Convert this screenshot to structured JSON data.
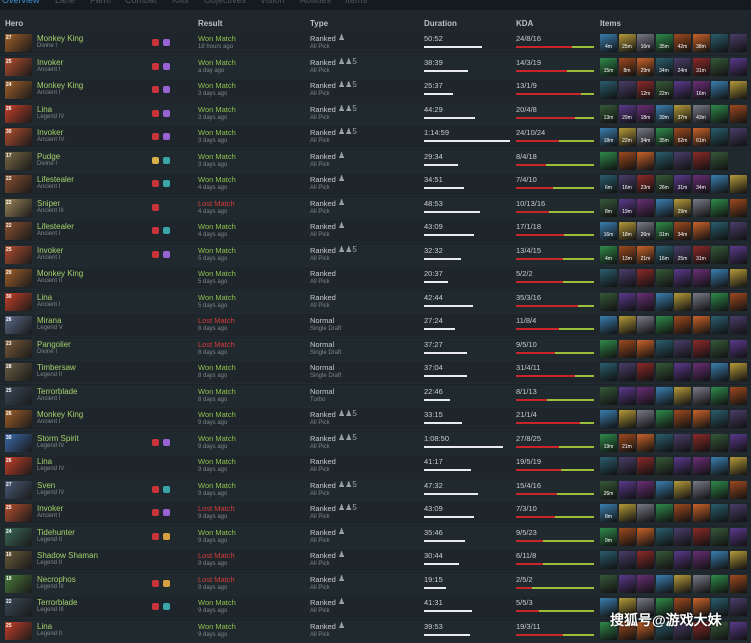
{
  "tabs": [
    "Overview",
    "Lane",
    "Farm",
    "Combat",
    "Kills",
    "Objectives",
    "Vision",
    "Abilities",
    "Items"
  ],
  "active_tab": 0,
  "headers": {
    "hero": "Hero",
    "result": "Result",
    "type": "Type",
    "duration": "Duration",
    "kda": "KDA",
    "items": "Items"
  },
  "matches": [
    {
      "lvl": "27",
      "hero": "Monkey King",
      "rank": "Divine I",
      "result": "Won Match",
      "won": true,
      "when": "18 hours ago",
      "type": "Ranked",
      "mode": "All Pick",
      "party": "♟",
      "duration": "50:52",
      "dur_min": 50.9,
      "kda": "24/8/16",
      "kda_red": 0.72,
      "lane": [
        "#c9343a",
        "#9a63d3"
      ],
      "times": [
        "4m",
        "25m",
        "16m",
        "35m",
        "42m",
        "38m"
      ],
      "portrait": "#a2602a"
    },
    {
      "lvl": "25",
      "hero": "Invoker",
      "rank": "Ancient I",
      "result": "Won Match",
      "won": true,
      "when": "a day ago",
      "type": "Ranked",
      "mode": "All Pick",
      "party": "♟♟5",
      "duration": "38:39",
      "dur_min": 38.7,
      "kda": "14/3/19",
      "kda_red": 0.65,
      "lane": [
        "#c9343a",
        "#9a63d3"
      ],
      "times": [
        "15m",
        "8m",
        "29m",
        "34m",
        "24m",
        "31m"
      ],
      "portrait": "#b54f2e"
    },
    {
      "lvl": "24",
      "hero": "Monkey King",
      "rank": "Ancient I",
      "result": "Won Match",
      "won": true,
      "when": "3 days ago",
      "type": "Ranked",
      "mode": "All Pick",
      "party": "♟♟5",
      "duration": "25:37",
      "dur_min": 25.6,
      "kda": "13/1/9",
      "kda_red": 0.83,
      "lane": [
        "#c9343a",
        "#9a63d3"
      ],
      "times": [
        "",
        "",
        "12m",
        "22m",
        "",
        "16m"
      ],
      "portrait": "#a2602a"
    },
    {
      "lvl": "26",
      "hero": "Lina",
      "rank": "Legend IV",
      "result": "Won Match",
      "won": true,
      "when": "3 days ago",
      "type": "Ranked",
      "mode": "All Pick",
      "party": "♟♟5",
      "duration": "44:29",
      "dur_min": 44.5,
      "kda": "20/4/8",
      "kda_red": 0.75,
      "lane": [
        "#c9343a",
        "#9a63d3"
      ],
      "times": [
        "13m",
        "29m",
        "18m",
        "39m",
        "37m",
        "43m"
      ],
      "portrait": "#c8402a"
    },
    {
      "lvl": "30",
      "hero": "Invoker",
      "rank": "Ancient IV",
      "result": "Won Match",
      "won": true,
      "when": "3 days ago",
      "type": "Ranked",
      "mode": "All Pick",
      "party": "♟♟5",
      "duration": "1:14:59",
      "dur_min": 75.0,
      "kda": "24/10/24",
      "kda_red": 0.55,
      "lane": [
        "#c9343a",
        "#9a63d3"
      ],
      "times": [
        "18m",
        "22m",
        "34m",
        "35m",
        "52m",
        "61m"
      ],
      "portrait": "#b54f2e"
    },
    {
      "lvl": "17",
      "hero": "Pudge",
      "rank": "Divine I",
      "result": "Won Match",
      "won": true,
      "when": "3 days ago",
      "type": "Ranked",
      "mode": "All Pick",
      "party": "♟",
      "duration": "29:34",
      "dur_min": 29.6,
      "kda": "8/4/18",
      "kda_red": 0.38,
      "lane": [
        "#d9b04a",
        "#3aa6a8"
      ],
      "times": [
        "",
        "",
        "",
        "",
        "",
        ""
      ],
      "portrait": "#7a6a46"
    },
    {
      "lvl": "22",
      "hero": "Lifestealer",
      "rank": "Ancient I",
      "result": "Won Match",
      "won": true,
      "when": "4 days ago",
      "type": "Ranked",
      "mode": "All Pick",
      "party": "♟",
      "duration": "34:51",
      "dur_min": 34.9,
      "kda": "7/4/10",
      "kda_red": 0.48,
      "lane": [
        "#c9343a",
        "#3aa6a8"
      ],
      "times": [
        "6m",
        "16m",
        "23m",
        "26m",
        "31m",
        "34m"
      ],
      "portrait": "#8a5030"
    },
    {
      "lvl": "22",
      "hero": "Sniper",
      "rank": "Ancient III",
      "result": "Lost Match",
      "won": false,
      "when": "4 days ago",
      "type": "Ranked",
      "mode": "All Pick",
      "party": "♟",
      "duration": "48:53",
      "dur_min": 48.9,
      "kda": "10/13/16",
      "kda_red": 0.42,
      "lane": [
        "#c9343a"
      ],
      "times": [
        "8m",
        "19m",
        "",
        "",
        "29m",
        ""
      ],
      "portrait": "#9c8658"
    },
    {
      "lvl": "22",
      "hero": "Lifestealer",
      "rank": "Ancient I",
      "result": "Won Match",
      "won": true,
      "when": "4 days ago",
      "type": "Ranked",
      "mode": "All Pick",
      "party": "♟",
      "duration": "43:09",
      "dur_min": 43.2,
      "kda": "17/1/18",
      "kda_red": 0.62,
      "lane": [
        "#c9343a",
        "#3aa6a8"
      ],
      "times": [
        "16m",
        "18m",
        "26m",
        "31m",
        "34m",
        ""
      ],
      "portrait": "#8a5030"
    },
    {
      "lvl": "25",
      "hero": "Invoker",
      "rank": "Ancient I",
      "result": "Won Match",
      "won": true,
      "when": "5 days ago",
      "type": "Ranked",
      "mode": "All Pick",
      "party": "♟♟5",
      "duration": "32:32",
      "dur_min": 32.5,
      "kda": "13/4/15",
      "kda_red": 0.6,
      "lane": [
        "#c9343a",
        "#9a63d3"
      ],
      "times": [
        "4m",
        "13m",
        "21m",
        "16m",
        "25m",
        "31m"
      ],
      "portrait": "#b54f2e"
    },
    {
      "lvl": "20",
      "hero": "Monkey King",
      "rank": "Ancient II",
      "result": "Won Match",
      "won": true,
      "when": "5 days ago",
      "type": "Ranked",
      "mode": "All Pick",
      "party": "",
      "duration": "20:37",
      "dur_min": 20.6,
      "kda": "5/2/2",
      "kda_red": 0.6,
      "lane": [],
      "times": [
        "",
        "",
        "",
        "",
        "",
        ""
      ],
      "portrait": "#a2602a"
    },
    {
      "lvl": "30",
      "hero": "Lina",
      "rank": "Ancient I",
      "result": "Won Match",
      "won": true,
      "when": "5 days ago",
      "type": "Ranked",
      "mode": "All Pick",
      "party": "",
      "duration": "42:44",
      "dur_min": 42.7,
      "kda": "35/3/16",
      "kda_red": 0.8,
      "lane": [],
      "times": [
        "",
        "",
        "",
        "",
        "",
        ""
      ],
      "portrait": "#c8402a"
    },
    {
      "lvl": "26",
      "hero": "Mirana",
      "rank": "Legend V",
      "result": "Lost Match",
      "won": false,
      "when": "8 days ago",
      "type": "Normal",
      "mode": "Single Draft",
      "party": "",
      "duration": "27:24",
      "dur_min": 27.4,
      "kda": "11/8/4",
      "kda_red": 0.55,
      "lane": [],
      "times": [
        "",
        "",
        "",
        "",
        "",
        ""
      ],
      "portrait": "#5a6a88"
    },
    {
      "lvl": "23",
      "hero": "Pangolier",
      "rank": "Divine I",
      "result": "Lost Match",
      "won": false,
      "when": "8 days ago",
      "type": "Normal",
      "mode": "Single Draft",
      "party": "",
      "duration": "37:27",
      "dur_min": 37.5,
      "kda": "9/5/10",
      "kda_red": 0.5,
      "lane": [],
      "times": [
        "",
        "",
        "",
        "",
        "",
        ""
      ],
      "portrait": "#7a5a3a"
    },
    {
      "lvl": "28",
      "hero": "Timbersaw",
      "rank": "Legend II",
      "result": "Won Match",
      "won": true,
      "when": "8 days ago",
      "type": "Normal",
      "mode": "Single Draft",
      "party": "",
      "duration": "37:04",
      "dur_min": 37.1,
      "kda": "31/4/11",
      "kda_red": 0.75,
      "lane": [],
      "times": [
        "",
        "",
        "",
        "",
        "",
        ""
      ],
      "portrait": "#6a5e44"
    },
    {
      "lvl": "25",
      "hero": "Terrorblade",
      "rank": "Ancient I",
      "result": "Won Match",
      "won": true,
      "when": "8 days ago",
      "type": "Normal",
      "mode": "Turbo",
      "party": "",
      "duration": "22:46",
      "dur_min": 22.8,
      "kda": "8/1/13",
      "kda_red": 0.4,
      "lane": [],
      "times": [
        "",
        "",
        "",
        "",
        "",
        ""
      ],
      "portrait": "#3a4a5a"
    },
    {
      "lvl": "26",
      "hero": "Monkey King",
      "rank": "Ancient I",
      "result": "Won Match",
      "won": true,
      "when": "9 days ago",
      "type": "Ranked",
      "mode": "All Pick",
      "party": "♟♟5",
      "duration": "33:15",
      "dur_min": 33.3,
      "kda": "21/1/4",
      "kda_red": 0.82,
      "lane": [],
      "times": [
        "",
        "",
        "",
        "",
        "",
        ""
      ],
      "portrait": "#a2602a"
    },
    {
      "lvl": "30",
      "hero": "Storm Spirit",
      "rank": "Legend IV",
      "result": "Won Match",
      "won": true,
      "when": "9 days ago",
      "type": "Ranked",
      "mode": "All Pick",
      "party": "♟♟5",
      "duration": "1:08:50",
      "dur_min": 68.8,
      "kda": "27/8/25",
      "kda_red": 0.55,
      "lane": [
        "#c9343a",
        "#9a63d3"
      ],
      "times": [
        "19m",
        "21m",
        "",
        "",
        "",
        ""
      ],
      "portrait": "#3a6aa8"
    },
    {
      "lvl": "26",
      "hero": "Lina",
      "rank": "Legend IV",
      "result": "Won Match",
      "won": true,
      "when": "9 days ago",
      "type": "Ranked",
      "mode": "All Pick",
      "party": "",
      "duration": "41:17",
      "dur_min": 41.3,
      "kda": "19/5/19",
      "kda_red": 0.58,
      "lane": [],
      "times": [
        "",
        "",
        "",
        "",
        "",
        ""
      ],
      "portrait": "#c8402a"
    },
    {
      "lvl": "27",
      "hero": "Sven",
      "rank": "Legend IV",
      "result": "Won Match",
      "won": true,
      "when": "9 days ago",
      "type": "Ranked",
      "mode": "All Pick",
      "party": "♟♟5",
      "duration": "47:32",
      "dur_min": 47.5,
      "kda": "15/4/16",
      "kda_red": 0.52,
      "lane": [
        "#c9343a",
        "#3aa6a8"
      ],
      "times": [
        "26m",
        "",
        "",
        "",
        "",
        ""
      ],
      "portrait": "#4a5a78"
    },
    {
      "lvl": "25",
      "hero": "Invoker",
      "rank": "Ancient I",
      "result": "Lost Match",
      "won": false,
      "when": "9 days ago",
      "type": "Ranked",
      "mode": "All Pick",
      "party": "♟♟5",
      "duration": "43:09",
      "dur_min": 43.2,
      "kda": "7/3/10",
      "kda_red": 0.5,
      "lane": [
        "#c9343a",
        "#9a63d3"
      ],
      "times": [
        "8m",
        "",
        "",
        "",
        "",
        ""
      ],
      "portrait": "#b54f2e"
    },
    {
      "lvl": "24",
      "hero": "Tidehunter",
      "rank": "Legend II",
      "result": "Won Match",
      "won": true,
      "when": "9 days ago",
      "type": "Ranked",
      "mode": "All Pick",
      "party": "♟",
      "duration": "35:46",
      "dur_min": 35.8,
      "kda": "9/5/23",
      "kda_red": 0.35,
      "lane": [
        "#c9343a",
        "#d9a040"
      ],
      "times": [
        "9m",
        "",
        "",
        "",
        "",
        ""
      ],
      "portrait": "#3a6a5a"
    },
    {
      "lvl": "16",
      "hero": "Shadow Shaman",
      "rank": "Legend II",
      "result": "Lost Match",
      "won": false,
      "when": "9 days ago",
      "type": "Ranked",
      "mode": "All Pick",
      "party": "♟",
      "duration": "30:44",
      "dur_min": 30.7,
      "kda": "6/11/8",
      "kda_red": 0.35,
      "lane": [],
      "times": [
        "",
        "",
        "",
        "",
        "",
        ""
      ],
      "portrait": "#6a5a3a"
    },
    {
      "lvl": "19",
      "hero": "Necrophos",
      "rank": "Legend III",
      "result": "Lost Match",
      "won": false,
      "when": "9 days ago",
      "type": "Ranked",
      "mode": "All Pick",
      "party": "♟",
      "duration": "19:15",
      "dur_min": 19.3,
      "kda": "2/5/2",
      "kda_red": 0.2,
      "lane": [
        "#c9343a",
        "#d9a040"
      ],
      "times": [
        "",
        "",
        "",
        "",
        "",
        ""
      ],
      "portrait": "#4a7a3a"
    },
    {
      "lvl": "22",
      "hero": "Terrorblade",
      "rank": "Legend III",
      "result": "Won Match",
      "won": true,
      "when": "9 days ago",
      "type": "Ranked",
      "mode": "All Pick",
      "party": "♟",
      "duration": "41:31",
      "dur_min": 41.5,
      "kda": "5/5/3",
      "kda_red": 0.3,
      "lane": [
        "#c9343a",
        "#3aa6a8"
      ],
      "times": [
        "",
        "",
        "",
        "",
        "",
        ""
      ],
      "portrait": "#3a4a5a"
    },
    {
      "lvl": "25",
      "hero": "Lina",
      "rank": "Legend II",
      "result": "Won Match",
      "won": true,
      "when": "9 days ago",
      "type": "Ranked",
      "mode": "All Pick",
      "party": "♟",
      "duration": "39:53",
      "dur_min": 39.9,
      "kda": "19/3/11",
      "kda_red": 0.6,
      "lane": [],
      "times": [
        "",
        "",
        "",
        "",
        "",
        ""
      ],
      "portrait": "#c8402a"
    }
  ],
  "item_palette": [
    "#3b7fb0",
    "#c8632a",
    "#5b3a8c",
    "#2f8a4a",
    "#8c2a2a",
    "#b59a3a",
    "#2a5e6e",
    "#6a2f78",
    "#9e4a1f",
    "#375a3a",
    "#7a7a88",
    "#4a3e6a"
  ],
  "watermark": "搜狐号@游戏大妹"
}
